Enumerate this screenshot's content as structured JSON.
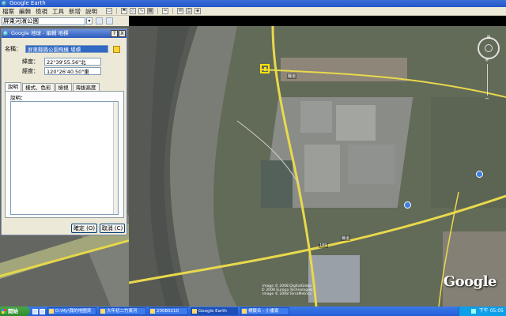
{
  "window": {
    "title": "Google Earth"
  },
  "menu": [
    "檔案",
    "編輯",
    "檢視",
    "工具",
    "新增",
    "說明"
  ],
  "search": {
    "value": "屏東河濱公園"
  },
  "dialog": {
    "title": "Google 地球 - 編輯 地標",
    "name_label": "名稱：",
    "name_value": "屏東縣縣公園飛機 場標",
    "lat_label": "緯度：",
    "lat_value": "22°39'55.56\"北",
    "lon_label": "經度：",
    "lon_value": "120°26'40.50\"東",
    "tabs": [
      "說明",
      "樣式、色彩",
      "檢視",
      "海拔高度"
    ],
    "desc_label": "說明：",
    "ok": "確定 (O)",
    "cancel": "取消 (C)",
    "help_btn": "?",
    "close_btn": "X"
  },
  "map": {
    "compass_n": "N",
    "copyright": "Image © 2008 DigitalGlobe\n© 2008 Europa Technologies\nImage © 2008 TerraMetrics",
    "logo": "Google",
    "road_labels": [
      "縣道",
      "縣道",
      "189"
    ]
  },
  "taskbar": {
    "start": "開始",
    "tasks": [
      "D:\\My\\我的地圖資",
      "大年初二竹東河",
      "20080210",
      "Google Earth",
      "標籤名 - 小畫家"
    ],
    "clock": "下午 05:05"
  },
  "colors": {
    "accent": "#316ac5",
    "placemark": "#ffe400",
    "taskbar": "#245dd8"
  }
}
